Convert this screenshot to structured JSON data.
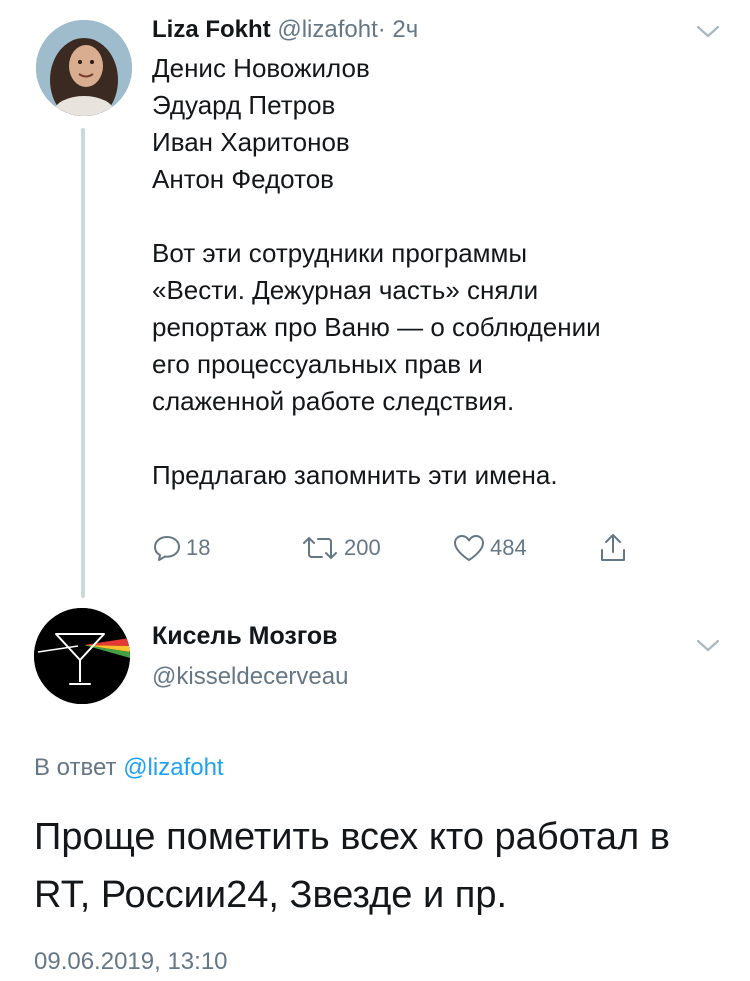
{
  "tweet1": {
    "author_name": "Liza Fokht",
    "author_handle": "@lizafoht",
    "time": "· 2ч",
    "names": [
      "Денис Новожилов",
      "Эдуард Петров",
      "Иван Харитонов",
      "Антон Федотов"
    ],
    "paragraph1": [
      "Вот эти сотрудники программы",
      "«Вести. Дежурная часть» сняли",
      "репортаж про Ваню — о соблюдении",
      "его процессуальных прав и",
      "слаженной работе следствия."
    ],
    "paragraph2": "Предлагаю запомнить эти имена.",
    "actions": {
      "reply_count": "18",
      "retweet_count": "200",
      "like_count": "484"
    },
    "avatar_icon": "profile-photo"
  },
  "tweet2": {
    "author_name": "Кисель Мозгов",
    "author_handle": "@kisseldecerveau",
    "reply_prefix": "В ответ",
    "reply_to": "@lizafoht",
    "text": "Проще пометить всех кто работал в RT, России24, Звезде и пр.",
    "timestamp": "09.06.2019, 13:10",
    "avatar_icon": "martini-glass-prism-logo"
  },
  "colors": {
    "text": "#14171a",
    "secondary": "#657786",
    "accent": "#1da1f2",
    "thread_line": "#ccd6dd"
  }
}
